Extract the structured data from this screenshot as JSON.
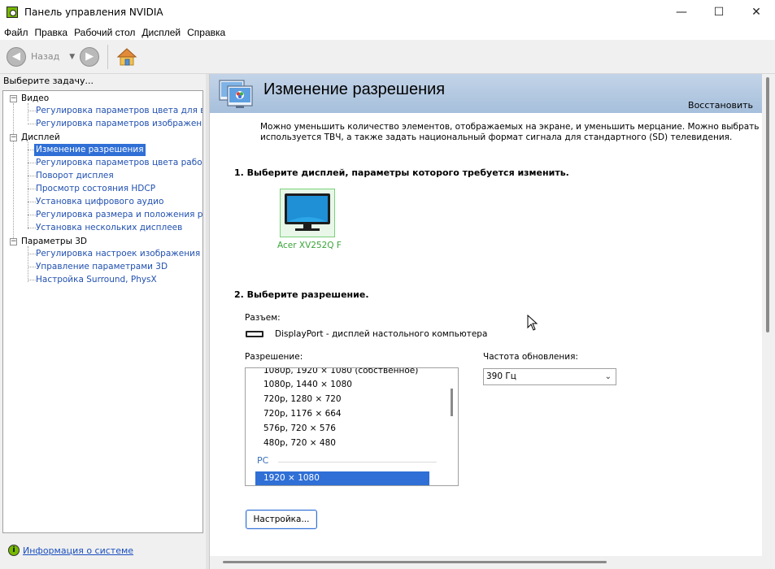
{
  "window": {
    "title": "Панель управления NVIDIA",
    "controls": {
      "minimize": "—",
      "maximize": "☐",
      "close": "✕"
    }
  },
  "menu": [
    "Файл",
    "Правка",
    "Рабочий стол",
    "Дисплей",
    "Справка"
  ],
  "toolbar": {
    "back_label": "Назад",
    "icons": [
      "back-arrow-icon",
      "dropdown-arrow-icon",
      "forward-arrow-icon",
      "home-icon"
    ]
  },
  "sidebar": {
    "prompt": "Выберите задачу...",
    "categories": [
      {
        "label": "Видео",
        "items": [
          {
            "label": "Регулировка параметров цвета для вид"
          },
          {
            "label": "Регулировка параметров изображения д"
          }
        ]
      },
      {
        "label": "Дисплей",
        "items": [
          {
            "label": "Изменение разрешения",
            "selected": true
          },
          {
            "label": "Регулировка параметров цвета рабочег"
          },
          {
            "label": "Поворот дисплея"
          },
          {
            "label": "Просмотр состояния HDCP"
          },
          {
            "label": "Установка цифрового аудио"
          },
          {
            "label": "Регулировка размера и положения рабо"
          },
          {
            "label": "Установка нескольких дисплеев"
          }
        ]
      },
      {
        "label": "Параметры 3D",
        "items": [
          {
            "label": "Регулировка настроек изображения с пр"
          },
          {
            "label": "Управление параметрами 3D"
          },
          {
            "label": "Настройка Surround, PhysX"
          }
        ]
      }
    ],
    "system_info_link": "Информация о системе"
  },
  "page": {
    "title": "Изменение разрешения",
    "restore_link": "Восстановить",
    "description_line1": "Можно уменьшить количество элементов, отображаемых на экране, и уменьшить мерцание. Можно выбрать высококач",
    "description_line2": "используется ТВЧ, а также задать национальный формат сигнала для стандартного (SD) телевидения.",
    "step1": "1. Выберите дисплей, параметры которого требуется изменить.",
    "monitor_name": "Acer XV252Q F",
    "step2": "2. Выберите разрешение.",
    "connector_label": "Разъем:",
    "connector_value": "DisplayPort - дисплей настольного компьютера",
    "resolution_label": "Разрешение:",
    "resolutions": [
      "1080p, 1920 × 1080 (собственное)",
      "1080p, 1440 × 1080",
      "720p, 1280 × 720",
      "720p, 1176 × 664",
      "576p, 720 × 576",
      "480p, 720 × 480"
    ],
    "resolution_group": "PC",
    "resolution_selected": "1920 × 1080",
    "refresh_label": "Частота обновления:",
    "refresh_value": "390 Гц",
    "setup_button": "Настройка..."
  },
  "colors": {
    "accent": "#2f6fd6",
    "link": "#2050b0",
    "nvidia_green": "#76b900",
    "header_gradient_top": "#c3d4e8",
    "header_gradient_bottom": "#a6bfdb"
  }
}
